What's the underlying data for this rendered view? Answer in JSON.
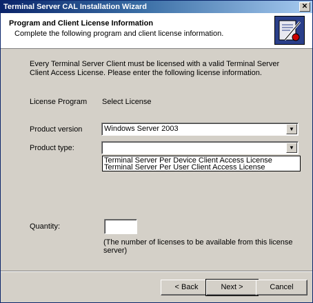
{
  "window": {
    "title": "Terminal Server CAL Installation Wizard",
    "close_glyph": "✕"
  },
  "header": {
    "title": "Program and Client License Information",
    "subtitle": "Complete the following program and client license information.",
    "icon": "wizard-certificate-icon"
  },
  "intro_text": "Every Terminal Server Client must be licensed with a valid Terminal Server Client Access License. Please enter the following license information.",
  "license_program": {
    "label": "License Program",
    "value": "Select License"
  },
  "product_version": {
    "label": "Product version",
    "selected": "Windows Server 2003"
  },
  "product_type": {
    "label": "Product type:",
    "selected": "",
    "options": [
      "Terminal Server Per Device Client Access License",
      "Terminal Server Per User Client Access License"
    ]
  },
  "quantity": {
    "label": "Quantity:",
    "value": "",
    "hint": "(The number of licenses to be available from this license server)"
  },
  "buttons": {
    "back": "< Back",
    "next": "Next >",
    "cancel": "Cancel"
  },
  "colors": {
    "titlebar_start": "#0a246a",
    "titlebar_end": "#a6caf0",
    "face": "#d4d0c8"
  }
}
